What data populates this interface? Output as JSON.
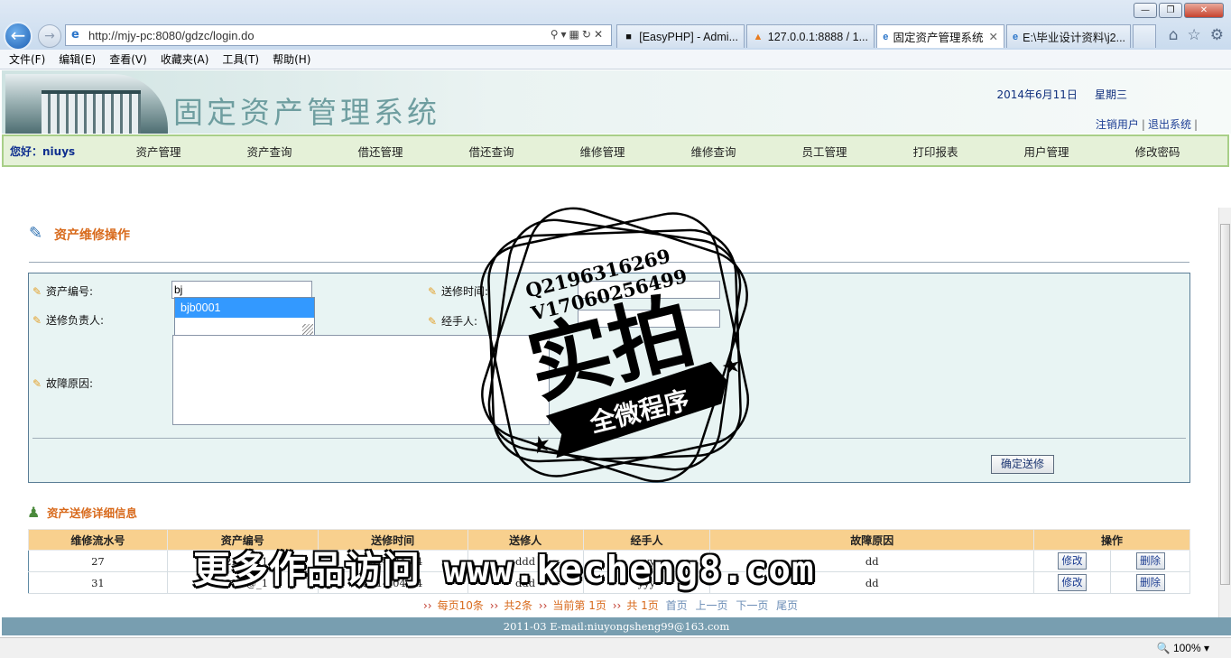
{
  "browser": {
    "url": "http://mjy-pc:8080/gdzc/login.do",
    "tabs": [
      {
        "label": "[EasyPHP] - Admi..."
      },
      {
        "label": "127.0.0.1:8888 / 1..."
      },
      {
        "label": "固定资产管理系统"
      },
      {
        "label": "E:\\毕业设计资料\\j2..."
      }
    ],
    "menu": [
      "文件(F)",
      "编辑(E)",
      "查看(V)",
      "收藏夹(A)",
      "工具(T)",
      "帮助(H)"
    ],
    "zoom": "100%"
  },
  "header": {
    "title": "固定资产管理系统",
    "date": "2014年6月11日",
    "weekday": "星期三",
    "links": {
      "logout_user": "注销用户",
      "exit": "退出系统"
    }
  },
  "nav": {
    "greeting": "您好：",
    "user": "niuys",
    "items": [
      "资产管理",
      "资产查询",
      "借还管理",
      "借还查询",
      "维修管理",
      "维修查询",
      "员工管理",
      "打印报表",
      "用户管理",
      "修改密码"
    ]
  },
  "repair_form": {
    "title": "资产维修操作",
    "asset_no_label": "资产编号:",
    "asset_no_value": "bj",
    "autocomplete_option": "bjb0001",
    "send_time_label": "送修时间:",
    "manager_label": "送修负责人:",
    "handler_label": "经手人:",
    "reason_label": "故障原因:",
    "submit_label": "确定送修"
  },
  "detail": {
    "title": "资产送修详细信息",
    "columns": [
      "维修流水号",
      "资产编号",
      "送修时间",
      "送修人",
      "经手人",
      "故障原因",
      "操作"
    ],
    "rows": [
      {
        "id": "27",
        "asset": "C2K5@_1",
        "time": "2014-04-04",
        "sender": "ddd",
        "handler": "yyy",
        "reason": "dd"
      },
      {
        "id": "31",
        "asset": "C2K5@_1",
        "time": "2014-04-04",
        "sender": "ddd",
        "handler": "yyy",
        "reason": "dd"
      }
    ],
    "edit_label": "修改",
    "delete_label": "删除"
  },
  "pager": {
    "per_page": "每页10条",
    "total_rows": "共2条",
    "current": "当前第",
    "current_num": "1页",
    "total_label": "共",
    "total_pages": "1页",
    "first": "首页",
    "prev": "上一页",
    "next": "下一页",
    "last": "尾页"
  },
  "footer": {
    "text": "2011-03 E-mail:niuyongsheng99@163.com"
  },
  "watermark": {
    "line1": "Q2196316269",
    "line2": "V17060256499",
    "big": "实拍",
    "ribbon": "全微程序",
    "site": "更多作品访问 www.kecheng8.com"
  }
}
